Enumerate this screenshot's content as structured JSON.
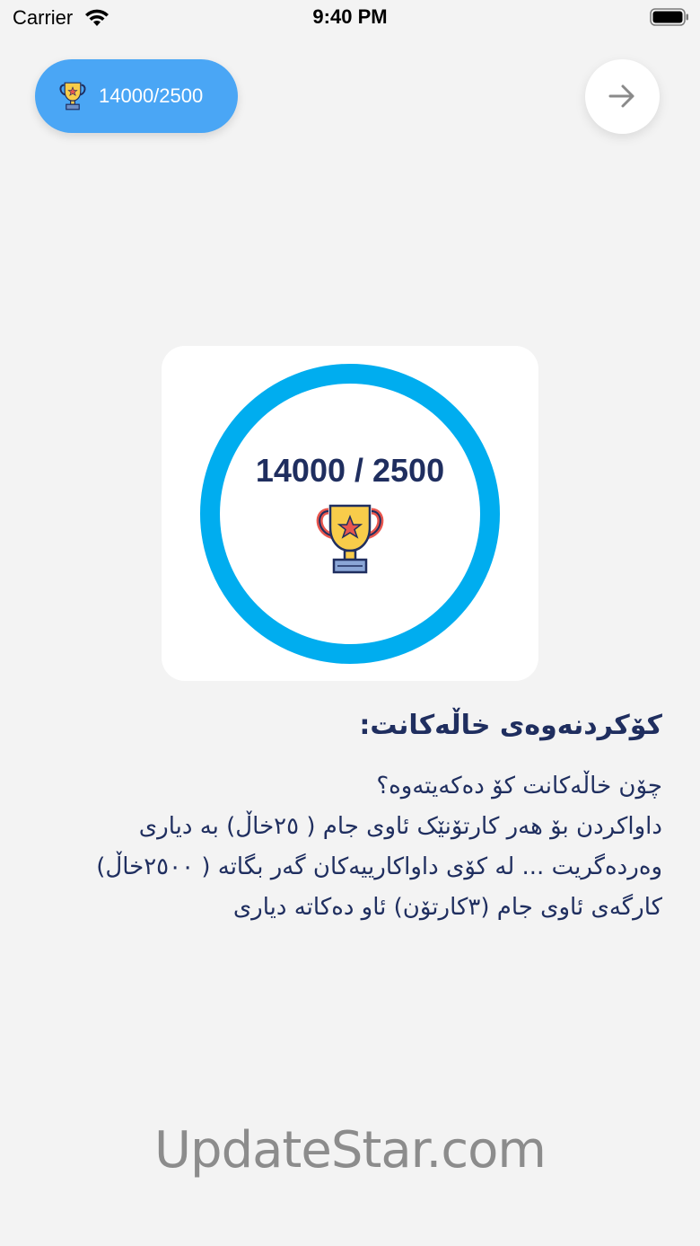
{
  "status_bar": {
    "carrier": "Carrier",
    "time": "9:40 PM",
    "wifi_icon": "wifi-icon",
    "battery_icon": "battery-icon"
  },
  "header": {
    "score_pill": {
      "icon": "trophy-icon",
      "text": "14000/2500",
      "color": "#4aa6f5"
    },
    "next_button": {
      "icon": "arrow-right-icon"
    }
  },
  "progress": {
    "text": "14000 / 2500",
    "icon": "trophy-icon",
    "ring_color": "#00adef",
    "fill_fraction": 1.0
  },
  "info": {
    "title": "کۆکردنەوەی خاڵەکانت:",
    "lines": [
      "چۆن خاڵەکانت کۆ دەکەیتەوە؟",
      "داواکردن بۆ هەر کارتۆنێک ئاوی جام ( ٢٥خاڵ) بە دیاری",
      "وەردەگریت ...  لە کۆی داواکارییەکان گەر بگاتە ( ٢٥٠٠خاڵ)",
      "کارگەی ئاوی جام  (٣کارتۆن) ئاو دەکاتە دیاری"
    ]
  },
  "watermark": {
    "text": "UpdateStar.com"
  },
  "colors": {
    "background": "#f3f3f3",
    "text_dark": "#1f2e5f",
    "accent_blue": "#4aa6f5",
    "ring_blue": "#00adef"
  }
}
